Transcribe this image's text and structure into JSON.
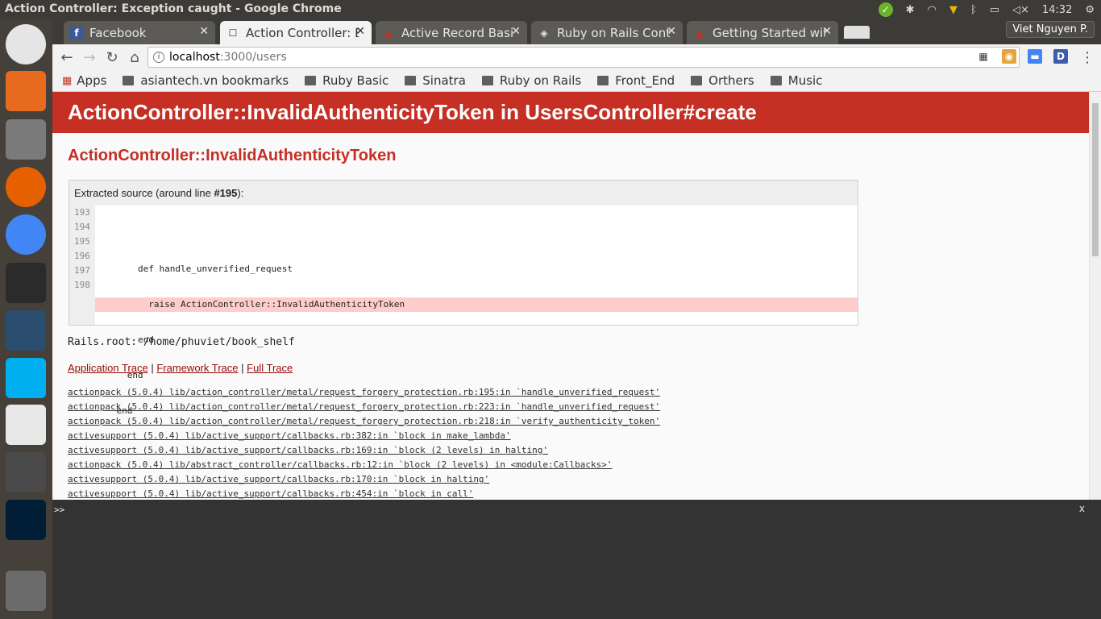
{
  "window": {
    "title": "Action Controller: Exception caught - Google Chrome"
  },
  "tray": {
    "time": "14:32"
  },
  "launcher": {
    "apps": [
      {
        "name": "ubuntu-dash",
        "color": "#e5e5e5"
      },
      {
        "name": "software-center",
        "color": "#e86a1e"
      },
      {
        "name": "files",
        "color": "#7a7a7a"
      },
      {
        "name": "firefox",
        "color": "#e66000"
      },
      {
        "name": "chrome",
        "color": "#4285f4"
      },
      {
        "name": "terminal",
        "color": "#2b2b2b"
      },
      {
        "name": "mysql-workbench",
        "color": "#2c4e6e"
      },
      {
        "name": "skype",
        "color": "#00aff0"
      },
      {
        "name": "slack",
        "color": "#e8e8e8"
      },
      {
        "name": "sublime-text",
        "color": "#4a4a4a"
      },
      {
        "name": "photoshop",
        "color": "#001e36"
      },
      {
        "name": "trash",
        "color": "#6b6b6b"
      }
    ]
  },
  "tabs": [
    {
      "label": "Facebook",
      "icon": "f"
    },
    {
      "label": "Action Controller: E",
      "icon": "☐"
    },
    {
      "label": "Active Record Basic",
      "icon": "▲"
    },
    {
      "label": "Ruby on Rails Contr",
      "icon": "◈"
    },
    {
      "label": "Getting Started wit",
      "icon": "▲"
    }
  ],
  "profile": {
    "name": "Viet Nguyen P."
  },
  "omnibox": {
    "host": "localhost",
    "path": ":3000/users"
  },
  "bookmarks": [
    "Apps",
    "asiantech.vn bookmarks",
    "Ruby Basic",
    "Sinatra",
    "Ruby on Rails",
    "Front_End",
    "Orthers",
    "Music"
  ],
  "page": {
    "banner": "ActionController::InvalidAuthenticityToken in UsersController#create",
    "exception": "ActionController::InvalidAuthenticityToken",
    "source_head_prefix": "Extracted source (around line ",
    "source_head_line": "#195",
    "source_head_suffix": "):",
    "line_numbers": [
      "193",
      "194",
      "195",
      "196",
      "197",
      "198"
    ],
    "code_lines": [
      "",
      "        def handle_unverified_request",
      "          raise ActionController::InvalidAuthenticityToken",
      "        end",
      "      end",
      "    end"
    ],
    "rails_root": "Rails.root: /home/phuviet/book_shelf",
    "trace_links": [
      "Application Trace",
      "Framework Trace",
      "Full Trace"
    ],
    "trace_sep": "|",
    "trace": [
      "actionpack (5.0.4) lib/action_controller/metal/request_forgery_protection.rb:195:in `handle_unverified_request'",
      "actionpack (5.0.4) lib/action_controller/metal/request_forgery_protection.rb:223:in `handle_unverified_request'",
      "actionpack (5.0.4) lib/action_controller/metal/request_forgery_protection.rb:218:in `verify_authenticity_token'",
      "activesupport (5.0.4) lib/active_support/callbacks.rb:382:in `block in make_lambda'",
      "activesupport (5.0.4) lib/active_support/callbacks.rb:169:in `block (2 levels) in halting'",
      "actionpack (5.0.4) lib/abstract_controller/callbacks.rb:12:in `block (2 levels) in <module:Callbacks>'",
      "activesupport (5.0.4) lib/active_support/callbacks.rb:170:in `block in halting'",
      "activesupport (5.0.4) lib/active_support/callbacks.rb:454:in `block in call'"
    ]
  },
  "console": {
    "prompt": ">>",
    "close": "x"
  }
}
